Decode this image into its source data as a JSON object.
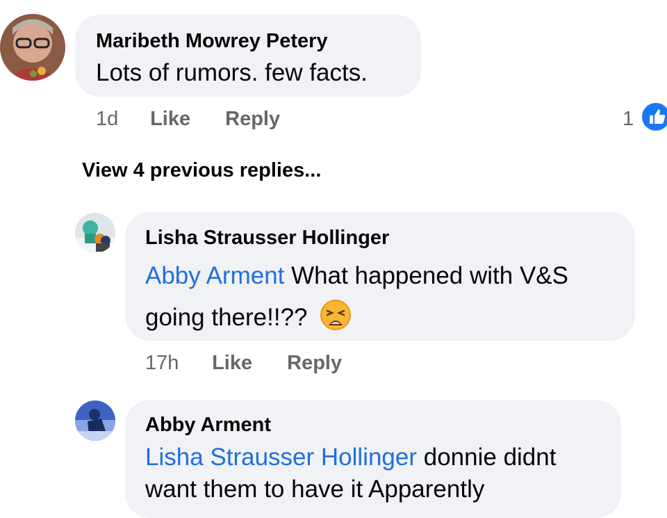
{
  "comment1": {
    "author": "Maribeth Mowrey Petery",
    "text": "Lots of rumors. few facts.",
    "time": "1d",
    "like_label": "Like",
    "reply_label": "Reply",
    "reaction_count": "1",
    "reaction_icon": "thumbs-up-icon"
  },
  "view_previous": "View 4 previous replies...",
  "reply1": {
    "author": "Lisha Strausser Hollinger",
    "mention": "Abby Arment",
    "text_line1": " What happened with V&S",
    "text_line2": "going there!!??",
    "emoji": "😩",
    "time": "17h",
    "like_label": "Like",
    "reply_label": "Reply"
  },
  "reply2": {
    "author": "Abby Arment",
    "mention": "Lisha Strausser Hollinger",
    "text_line1": " donnie didnt",
    "text_line2": "want them to have it Apparently"
  },
  "colors": {
    "bubble": "#f0f2f5",
    "mention": "#216fdb",
    "meta": "#65676b",
    "like_blue": "#1877f2"
  }
}
